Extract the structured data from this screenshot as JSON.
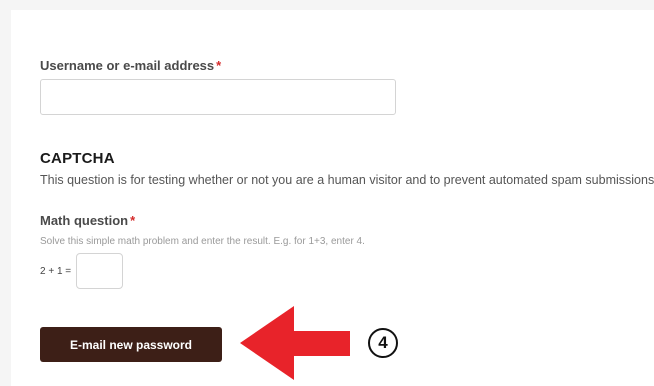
{
  "form": {
    "username_label": "Username or e-mail address",
    "required_mark": "*",
    "username_value": "",
    "captcha_title": "CAPTCHA",
    "captcha_description": "This question is for testing whether or not you are a human visitor and to prevent automated spam submissions.",
    "math_label": "Math question",
    "math_help": "Solve this simple math problem and enter the result. E.g. for 1+3, enter 4.",
    "math_equation": "2 + 1 =",
    "math_value": "",
    "submit_label": "E-mail new password"
  },
  "annotation": {
    "step_number": "4",
    "arrow_color": "#e8232a"
  },
  "colors": {
    "button_bg": "#3d1f17",
    "required": "#d42a2a"
  }
}
